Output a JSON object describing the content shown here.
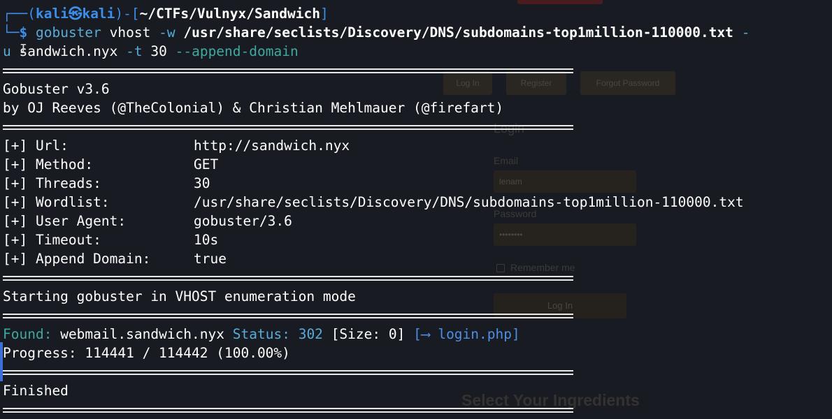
{
  "ghost_page": {
    "buttons": [
      "Log In",
      "Register",
      "Forgot Password"
    ],
    "login_heading": "Login",
    "email_label": "Email",
    "email_value": "lenam",
    "password_label": "Password",
    "password_value": "••••••••",
    "remember_label": "Remember me",
    "login_button": "Log In",
    "section_heading": "Select Your Ingredients"
  },
  "terminal": {
    "prompt": {
      "corner_top": "┌──(",
      "user": "kali",
      "at": "㉿",
      "host": "kali",
      "mid": ")-[",
      "path": "~/CTFs/Vulnyx/Sandwich",
      "close": "]",
      "corner_bottom": "└─",
      "dollar": "$"
    },
    "command": {
      "program": "gobuster",
      "mode": "vhost",
      "flag_w": "-w",
      "wordlist": "/usr/share/seclists/Discovery/DNS/subdomains-top1million-110000.txt",
      "dash_wrap": "-",
      "u_wrap": "u",
      "url": "sandwich.nyx",
      "flag_t": "-t",
      "threads": "30",
      "append": "--append-domain"
    },
    "banner": {
      "version": "Gobuster v3.6",
      "author": "by OJ Reeves (@TheColonial) & Christian Mehlmauer (@firefart)"
    },
    "config": [
      {
        "key": "[+] Url:",
        "value": "http://sandwich.nyx"
      },
      {
        "key": "[+] Method:",
        "value": "GET"
      },
      {
        "key": "[+] Threads:",
        "value": "30"
      },
      {
        "key": "[+] Wordlist:",
        "value": "/usr/share/seclists/Discovery/DNS/subdomains-top1million-110000.txt"
      },
      {
        "key": "[+] User Agent:",
        "value": "gobuster/3.6"
      },
      {
        "key": "[+] Timeout:",
        "value": "10s"
      },
      {
        "key": "[+] Append Domain:",
        "value": "true"
      }
    ],
    "start_message": "Starting gobuster in VHOST enumeration mode",
    "result": {
      "found_label": "Found:",
      "host": "webmail.sandwich.nyx",
      "status_label": "Status:",
      "status_code": "302",
      "size": "[Size: 0]",
      "redirect": "[⟶ login.php]"
    },
    "progress": "Progress: 114441 / 114442 (100.00%)",
    "finished": "Finished"
  },
  "colors": {
    "background": "#181b22",
    "prompt_blue": "#3b8eea",
    "found_teal": "#3ea9a0",
    "status_cyan": "#5aaad8",
    "text": "#ffffff"
  }
}
